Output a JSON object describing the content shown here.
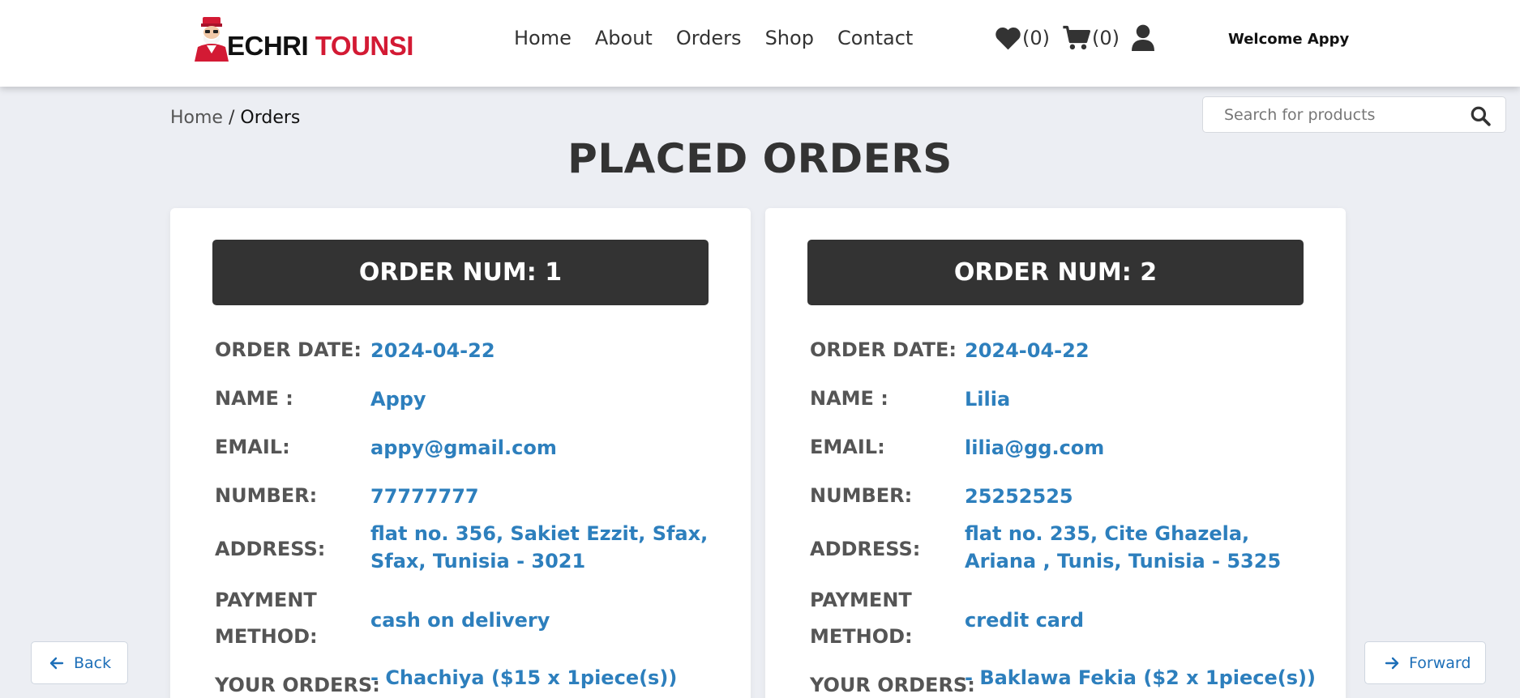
{
  "header": {
    "logo": {
      "text_dark": "ECHRI",
      "text_red": "TOUNSI"
    },
    "nav": [
      {
        "label": "Home"
      },
      {
        "label": "About"
      },
      {
        "label": "Orders"
      },
      {
        "label": "Shop"
      },
      {
        "label": "Contact"
      }
    ],
    "wishlist_count": "(0)",
    "cart_count": "(0)",
    "welcome": "Welcome Appy"
  },
  "breadcrumb": {
    "home": "Home",
    "separator": " / ",
    "current": "Orders"
  },
  "search": {
    "placeholder": "Search for products"
  },
  "page_title": "PLACED ORDERS",
  "labels": {
    "order_date": "ORDER DATE:",
    "name": "NAME :",
    "email": "EMAIL:",
    "number": "NUMBER:",
    "address": "ADDRESS:",
    "payment_line1": "PAYMENT",
    "payment_line2": "METHOD:",
    "your_orders": "YOUR ORDERS:"
  },
  "orders": [
    {
      "heading": "ORDER NUM: 1",
      "order_date": "2024-04-22",
      "name": "Appy",
      "email": "appy@gmail.com",
      "number": "77777777",
      "address": "flat no. 356, Sakiet Ezzit, Sfax, Sfax, Tunisia - 3021",
      "payment_method": "cash on delivery",
      "items": "- Chachiya ($15 x 1piece(s))"
    },
    {
      "heading": "ORDER NUM: 2",
      "order_date": "2024-04-22",
      "name": "Lilia",
      "email": "lilia@gg.com",
      "number": "25252525",
      "address": "flat no. 235, Cite Ghazela, Ariana , Tunis, Tunisia - 5325",
      "payment_method": "credit card",
      "items": "- Baklawa Fekia ($2 x 1piece(s))"
    }
  ],
  "buttons": {
    "back": "Back",
    "forward": "Forward"
  },
  "colors": {
    "accent": "#2d7fbd",
    "brand_red": "#d31a34",
    "header_bar": "#333333"
  }
}
